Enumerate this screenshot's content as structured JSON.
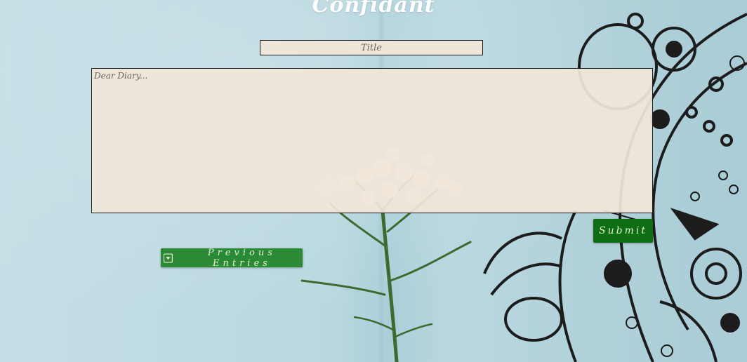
{
  "app": {
    "title": "Confidant"
  },
  "form": {
    "title_placeholder": "Title",
    "title_value": "",
    "entry_placeholder": "Dear Diary...",
    "entry_value": "",
    "submit_label": "Submit"
  },
  "history": {
    "previous_label": "Previous Entries",
    "icon": "caret-down-box-icon"
  },
  "colors": {
    "background": "#b8d6de",
    "input_bg": "#efe6da",
    "submit_bg": "#0e6e13",
    "previous_bg": "#2b8a35",
    "button_text": "#e6efcf"
  }
}
